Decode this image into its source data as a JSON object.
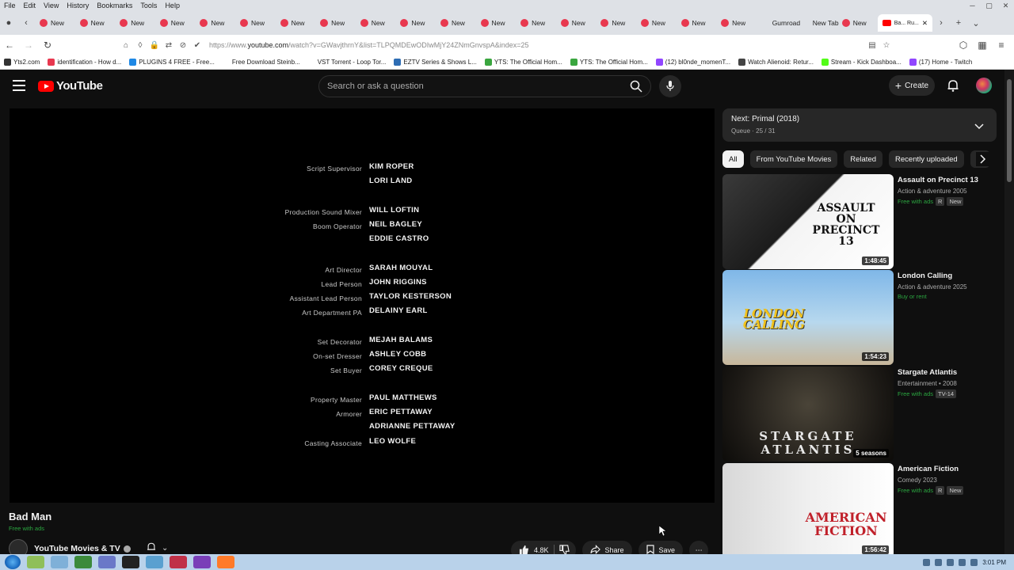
{
  "browser": {
    "menu": [
      "File",
      "Edit",
      "View",
      "History",
      "Bookmarks",
      "Tools",
      "Help"
    ],
    "tabs": [
      "New",
      "New",
      "New",
      "New",
      "New",
      "New",
      "New",
      "New",
      "New",
      "New",
      "New",
      "New",
      "New",
      "New",
      "New",
      "New",
      "New",
      "New",
      "Gumroad",
      "New Tab",
      "New"
    ],
    "active_tab": "Ba... Ru...",
    "url_prefix": "https://www.",
    "url_domain": "youtube.com",
    "url_rest": "/watch?v=GWavjthrnY&list=TLPQMDEwODIwMjY24ZNmGnvspA&index=25",
    "bookmarks": [
      {
        "label": "Yts2.com",
        "color": "#333333"
      },
      {
        "label": "identification - How d...",
        "color": "#e8384f"
      },
      {
        "label": "PLUGINS 4 FREE - Free...",
        "color": "#1e88e5"
      },
      {
        "label": "Free Download Steinb...",
        "color": "#ffffff"
      },
      {
        "label": "VST Torrent - Loop Tor...",
        "color": "#ffffff"
      },
      {
        "label": "EZTV Series & Shows L...",
        "color": "#2e6db4"
      },
      {
        "label": "YTS: The Official Hom...",
        "color": "#3aa63f"
      },
      {
        "label": "YTS: The Official Hom...",
        "color": "#3aa63f"
      },
      {
        "label": "(12) bl0nde_momenT...",
        "color": "#9146ff"
      },
      {
        "label": "Watch Alienoid: Retur...",
        "color": "#444444"
      },
      {
        "label": "Stream - Kick Dashboa...",
        "color": "#53fc18"
      },
      {
        "label": "(17) Home - Twitch",
        "color": "#9146ff"
      }
    ]
  },
  "youtube": {
    "logo": "YouTube",
    "search_placeholder": "Search or ask a question",
    "create_label": "Create"
  },
  "credits": [
    {
      "role": "Script Supervisor",
      "name": "KIM ROPER"
    },
    {
      "role": "",
      "name": "LORI LAND"
    },
    {
      "role": "Production Sound Mixer",
      "name": "WILL LOFTIN"
    },
    {
      "role": "Boom Operator",
      "name": "NEIL BAGLEY"
    },
    {
      "role": "",
      "name": "EDDIE CASTRO"
    },
    {
      "role": "Art Director",
      "name": "SARAH MOUYAL"
    },
    {
      "role": "Lead Person",
      "name": "JOHN RIGGINS"
    },
    {
      "role": "Assistant Lead Person",
      "name": "TAYLOR KESTERSON"
    },
    {
      "role": "Art Department PA",
      "name": "DELAINY EARL"
    },
    {
      "role": "Set Decorator",
      "name": "MEJAH BALAMS"
    },
    {
      "role": "On-set Dresser",
      "name": "ASHLEY COBB"
    },
    {
      "role": "Set Buyer",
      "name": "COREY CREQUE"
    },
    {
      "role": "Property Master",
      "name": "PAUL MATTHEWS"
    },
    {
      "role": "Armorer",
      "name": "ERIC PETTAWAY"
    },
    {
      "role": "",
      "name": "ADRIANNE PETTAWAY"
    },
    {
      "role": "Casting Associate",
      "name": "LEO WOLFE"
    }
  ],
  "video": {
    "title": "Bad Man",
    "free_label": "Free with ads",
    "channel": "YouTube Movies & TV",
    "likes": "4.8K",
    "share": "Share",
    "save": "Save"
  },
  "queue": {
    "next": "Next: Primal (2018)",
    "count": "Queue · 25 / 31"
  },
  "chips": [
    "All",
    "From YouTube Movies",
    "Related",
    "Recently uploaded",
    "W"
  ],
  "recommendations": [
    {
      "title": "Assault on Precinct 13",
      "meta": "Action & adventure 2005",
      "badges": [
        "Free with ads",
        "R",
        "New"
      ],
      "duration": "1:48:45",
      "thumb_text": "ASSAULT ON PRECINCT 13"
    },
    {
      "title": "London Calling",
      "meta": "Action & adventure 2025",
      "badges": [
        "Buy or rent"
      ],
      "duration": "1:54:23",
      "thumb_text": "LONDON CALLING"
    },
    {
      "title": "Stargate Atlantis",
      "meta": "Entertainment • 2008",
      "badges": [
        "Free with ads",
        "TV-14"
      ],
      "duration": "5 seasons",
      "thumb_text": "STARGATE ATLANTIS"
    },
    {
      "title": "American Fiction",
      "meta": "Comedy 2023",
      "badges": [
        "Free with ads",
        "R",
        "New"
      ],
      "duration": "1:56:42",
      "thumb_text": "AMERICAN FICTION"
    }
  ],
  "taskbar": {
    "clock": "3:01 PM"
  }
}
